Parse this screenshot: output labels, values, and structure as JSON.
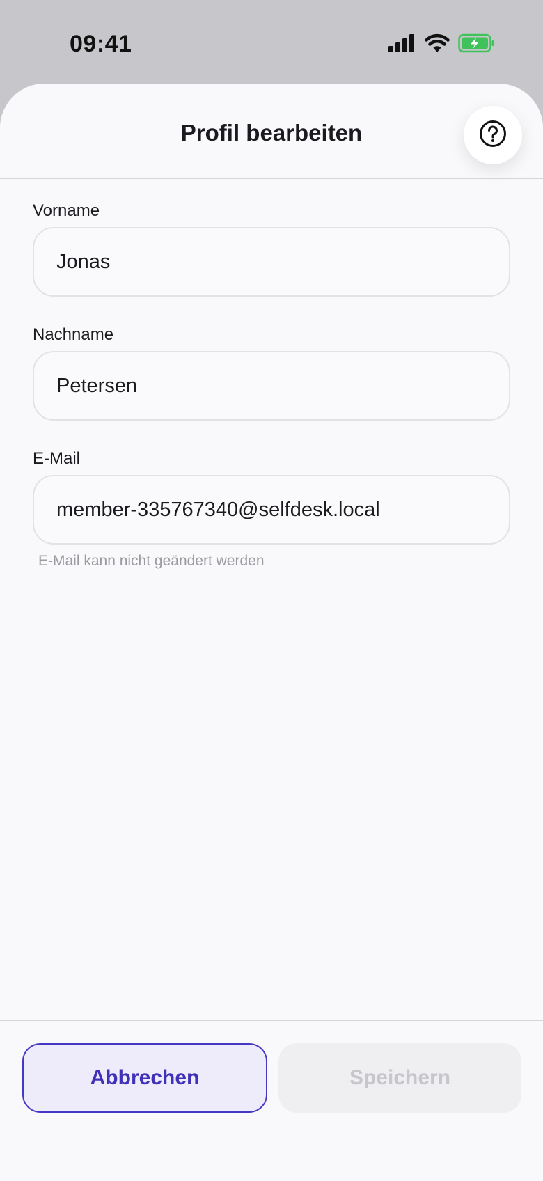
{
  "status_bar": {
    "time": "09:41",
    "icons": [
      "cellular-signal-icon",
      "wifi-icon",
      "battery-charging-icon"
    ]
  },
  "header": {
    "title": "Profil bearbeiten",
    "help_icon": "question-circle-icon"
  },
  "form": {
    "first_name": {
      "label": "Vorname",
      "value": "Jonas"
    },
    "last_name": {
      "label": "Nachname",
      "value": "Petersen"
    },
    "email": {
      "label": "E-Mail",
      "value": "member-335767340@selfdesk.local",
      "hint": "E-Mail kann nicht geändert werden"
    }
  },
  "footer": {
    "cancel_label": "Abbrechen",
    "save_label": "Speichern"
  },
  "colors": {
    "accent": "#4738c4",
    "battery": "#3fc25a",
    "disabled_text": "#c6c6cc"
  }
}
